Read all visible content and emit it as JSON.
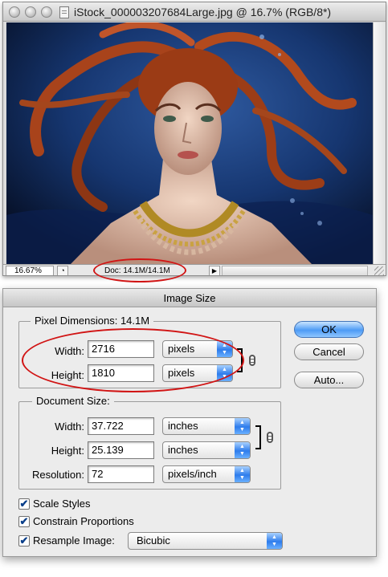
{
  "document_window": {
    "title": "iStock_000003207684Large.jpg @ 16.7% (RGB/8*)",
    "status_bar": {
      "zoom": "16.67%",
      "doc_info": "Doc: 14.1M/14.1M"
    }
  },
  "dialog": {
    "title": "Image Size",
    "pixel_dimensions": {
      "label": "Pixel Dimensions:",
      "size": "14.1M",
      "width": {
        "label": "Width:",
        "value": "2716",
        "unit": "pixels"
      },
      "height": {
        "label": "Height:",
        "value": "1810",
        "unit": "pixels"
      }
    },
    "document_size": {
      "label": "Document Size:",
      "width": {
        "label": "Width:",
        "value": "37.722",
        "unit": "inches"
      },
      "height": {
        "label": "Height:",
        "value": "25.139",
        "unit": "inches"
      },
      "resolution": {
        "label": "Resolution:",
        "value": "72",
        "unit": "pixels/inch"
      }
    },
    "buttons": {
      "ok": "OK",
      "cancel": "Cancel",
      "auto": "Auto..."
    },
    "options": {
      "scale_styles": {
        "label": "Scale Styles",
        "checked": true
      },
      "constrain_proportions": {
        "label": "Constrain Proportions",
        "checked": true
      },
      "resample_image": {
        "label": "Resample Image:",
        "checked": true,
        "method": "Bicubic"
      }
    }
  },
  "colors": {
    "annotation_red": "#d11414",
    "default_button_blue": "#4d9bf5",
    "dialog_background": "#ececec"
  },
  "icons": [
    "close-icon",
    "minimize-icon",
    "zoom-icon",
    "document-icon",
    "link-chain-icon",
    "checkmark-icon",
    "popup-arrows-icon",
    "disclosure-arrow-icon",
    "resize-grip-icon"
  ]
}
